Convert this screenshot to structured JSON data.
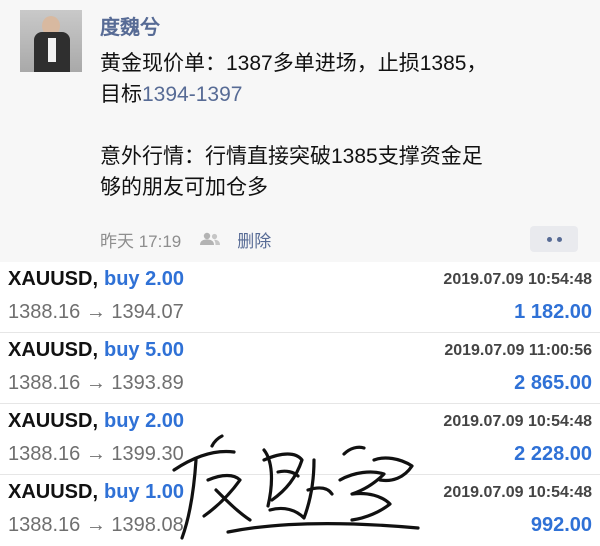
{
  "post": {
    "author": "度魏兮",
    "line1": "黄金现价单：1387多单进场，止损1385，",
    "line2_prefix": "目标",
    "line2_link": "1394-1397",
    "line3": "意外行情：行情直接突破1385支撑资金足",
    "line4": "够的朋友可加仓多",
    "time": "昨天 17:19",
    "delete_label": "删除"
  },
  "trades": [
    {
      "symbol": "XAUUSD,",
      "side": "buy 2.00",
      "datetime": "2019.07.09 10:54:48",
      "prices": "1388.16 → 1394.07",
      "profit": "1 182.00"
    },
    {
      "symbol": "XAUUSD,",
      "side": "buy 5.00",
      "datetime": "2019.07.09 11:00:56",
      "prices": "1388.16 → 1393.89",
      "profit": "2 865.00"
    },
    {
      "symbol": "XAUUSD,",
      "side": "buy 2.00",
      "datetime": "2019.07.09 10:54:48",
      "prices": "1388.16 → 1399.30",
      "profit": "2 228.00"
    },
    {
      "symbol": "XAUUSD,",
      "side": "buy 1.00",
      "datetime": "2019.07.09 10:54:48",
      "prices": "1388.16 → 1398.08",
      "profit": "992.00"
    }
  ],
  "colors": {
    "link": "#576b95",
    "profit": "#2f71d6",
    "post_bg": "#f7f7f7"
  },
  "icons": [
    "people-icon",
    "more-dots-icon"
  ]
}
